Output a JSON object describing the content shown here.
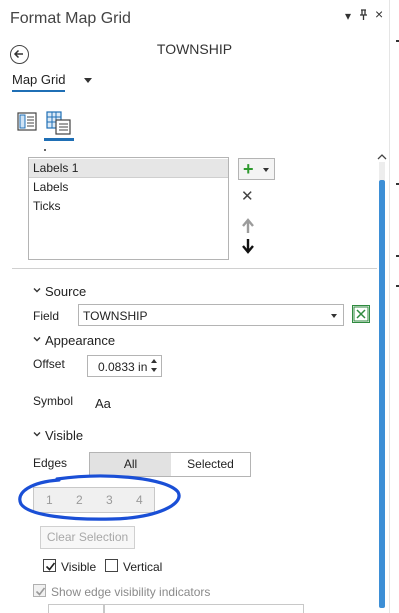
{
  "window": {
    "title": "Format Map Grid",
    "menu_glyph": "▾",
    "pin_glyph": "ᵖ",
    "close_glyph": "×"
  },
  "header": {
    "layer_name": "TOWNSHIP",
    "dropdown_label": "Map Grid"
  },
  "components": {
    "items": [
      "Labels 1",
      "Labels",
      "Ticks"
    ],
    "selected_index": 0,
    "add_glyph": "+",
    "delete_glyph": "✕"
  },
  "source": {
    "heading": "Source",
    "field_label": "Field",
    "field_value": "TOWNSHIP"
  },
  "appearance": {
    "heading": "Appearance",
    "offset_label": "Offset",
    "offset_value": "0.0833 in",
    "symbol_label": "Symbol",
    "symbol_preview": "Aa"
  },
  "visible": {
    "heading": "Visible",
    "edges_label": "Edges",
    "segment_all": "All",
    "segment_selected": "Selected",
    "active_segment": "All",
    "edge_buttons": [
      "1",
      "2",
      "3",
      "4"
    ],
    "clear_selection": "Clear Selection",
    "visible_checkbox": "Visible",
    "visible_checked": true,
    "vertical_checkbox": "Vertical",
    "vertical_checked": false,
    "show_indicators": "Show edge visibility indicators",
    "show_indicators_checked": true
  },
  "colors": {
    "accent": "#1f6fb5",
    "scrollbar": "#3d8fd6",
    "annotation": "#1a4fd6",
    "add_green": "#2e9a2e"
  }
}
